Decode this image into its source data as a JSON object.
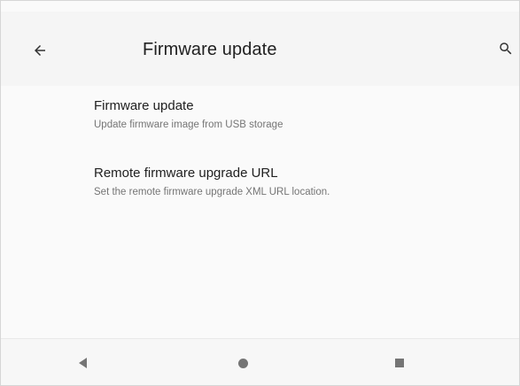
{
  "app_bar": {
    "title": "Firmware update",
    "back_icon": "arrow-back-icon",
    "search_icon": "search-icon"
  },
  "preferences": [
    {
      "title": "Firmware update",
      "summary": "Update firmware image from USB storage"
    },
    {
      "title": "Remote firmware upgrade URL",
      "summary": "Set the remote firmware upgrade XML URL location."
    }
  ],
  "nav_bar": {
    "back_icon": "nav-back-icon",
    "home_icon": "nav-home-icon",
    "recents_icon": "nav-recents-icon"
  },
  "colors": {
    "app_bar_background": "#f5f5f5",
    "text_primary": "#212121",
    "text_secondary": "#757575",
    "nav_icon": "#757575"
  }
}
